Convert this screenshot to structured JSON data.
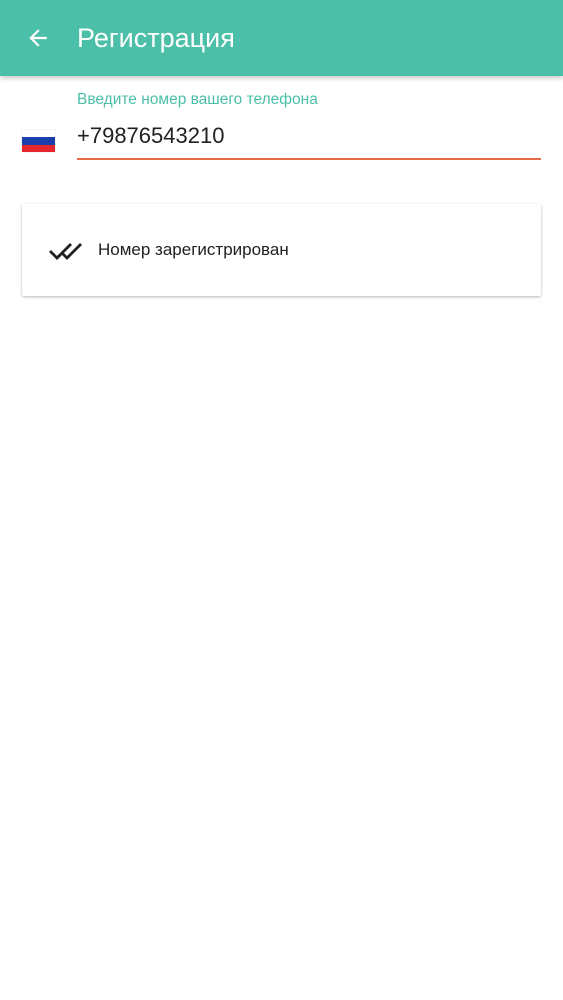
{
  "app_bar": {
    "title": "Регистрация",
    "back_icon": "arrow-back-icon",
    "color": "#4bbfa8"
  },
  "phone_field": {
    "label": "Введите номер вашего телефона",
    "value": "+79876543210",
    "flag_icon": "russia-flag-icon",
    "underline_color": "#e8694a"
  },
  "status": {
    "icon": "done-all-icon",
    "text": "Номер зарегистрирован"
  }
}
